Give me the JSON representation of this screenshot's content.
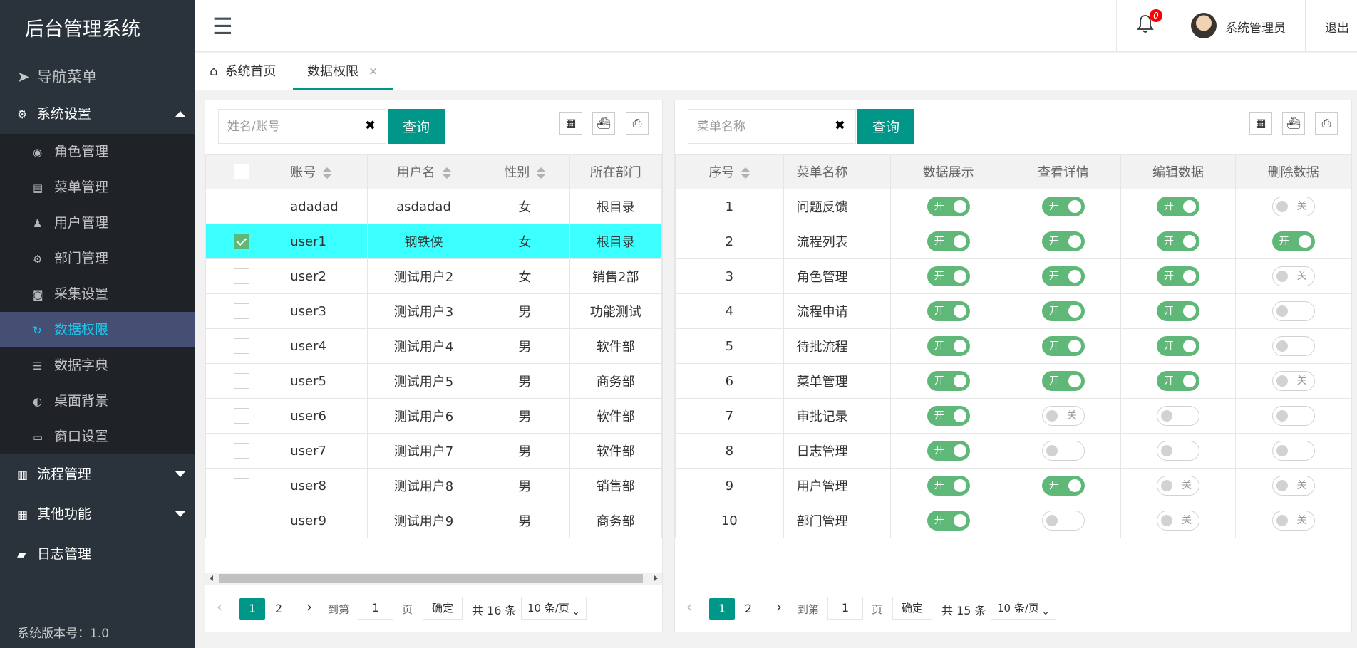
{
  "app": {
    "title": "后台管理系统",
    "version": "系统版本号：1.0"
  },
  "nav": {
    "header": "导航菜单",
    "groups": [
      {
        "label": "系统设置",
        "expanded": true,
        "icon": "gear-icon"
      },
      {
        "label": "流程管理",
        "expanded": false,
        "icon": "workflow-icon"
      },
      {
        "label": "其他功能",
        "expanded": false,
        "icon": "briefcase-icon"
      },
      {
        "label": "日志管理",
        "icon": "book-icon"
      }
    ],
    "sub_items": [
      {
        "label": "角色管理",
        "icon": "radio-icon"
      },
      {
        "label": "菜单管理",
        "icon": "server-icon"
      },
      {
        "label": "用户管理",
        "icon": "user-icon"
      },
      {
        "label": "部门管理",
        "icon": "cogs-icon"
      },
      {
        "label": "采集设置",
        "icon": "camera-icon"
      },
      {
        "label": "数据权限",
        "icon": "refresh-icon",
        "active": true
      },
      {
        "label": "数据字典",
        "icon": "list-icon"
      },
      {
        "label": "桌面背景",
        "icon": "theme-icon"
      },
      {
        "label": "窗口设置",
        "icon": "window-icon"
      }
    ]
  },
  "header": {
    "badge": "0",
    "user_name": "系统管理员",
    "logout": "退出"
  },
  "tabs": {
    "home": "系统首页",
    "active": "数据权限"
  },
  "left": {
    "search_placeholder": "姓名/账号",
    "query_label": "查询",
    "columns": [
      "账号",
      "用户名",
      "性别",
      "所在部门"
    ],
    "rows": [
      {
        "account": "adadad",
        "name": "asdadad",
        "gender": "女",
        "dept": "根目录",
        "checked": false
      },
      {
        "account": "user1",
        "name": "钢铁侠",
        "gender": "女",
        "dept": "根目录",
        "checked": true
      },
      {
        "account": "user2",
        "name": "测试用户2",
        "gender": "女",
        "dept": "销售2部",
        "checked": false
      },
      {
        "account": "user3",
        "name": "测试用户3",
        "gender": "男",
        "dept": "功能测试",
        "checked": false
      },
      {
        "account": "user4",
        "name": "测试用户4",
        "gender": "男",
        "dept": "软件部",
        "checked": false
      },
      {
        "account": "user5",
        "name": "测试用户5",
        "gender": "男",
        "dept": "商务部",
        "checked": false
      },
      {
        "account": "user6",
        "name": "测试用户6",
        "gender": "男",
        "dept": "软件部",
        "checked": false
      },
      {
        "account": "user7",
        "name": "测试用户7",
        "gender": "男",
        "dept": "软件部",
        "checked": false
      },
      {
        "account": "user8",
        "name": "测试用户8",
        "gender": "男",
        "dept": "销售部",
        "checked": false
      },
      {
        "account": "user9",
        "name": "测试用户9",
        "gender": "男",
        "dept": "商务部",
        "checked": false
      }
    ],
    "pager": {
      "pages": [
        "1",
        "2"
      ],
      "goto": "到第",
      "page_value": "1",
      "page_unit": "页",
      "ok": "确定",
      "total": "共 16 条",
      "size": "10 条/页"
    }
  },
  "right": {
    "search_placeholder": "菜单名称",
    "query_label": "查询",
    "columns": [
      "序号",
      "菜单名称",
      "数据展示",
      "查看详情",
      "编辑数据",
      "删除数据"
    ],
    "switch_on": "开",
    "switch_off": "关",
    "rows": [
      {
        "no": "1",
        "menu": "问题反馈",
        "s": [
          true,
          true,
          true,
          false
        ],
        "offText": [
          false,
          false,
          false,
          true
        ]
      },
      {
        "no": "2",
        "menu": "流程列表",
        "s": [
          true,
          true,
          true,
          true
        ],
        "offText": [
          false,
          false,
          false,
          false
        ]
      },
      {
        "no": "3",
        "menu": "角色管理",
        "s": [
          true,
          true,
          true,
          false
        ],
        "offText": [
          false,
          false,
          false,
          true
        ]
      },
      {
        "no": "4",
        "menu": "流程申请",
        "s": [
          true,
          true,
          true,
          false
        ],
        "offText": [
          false,
          false,
          false,
          false
        ]
      },
      {
        "no": "5",
        "menu": "待批流程",
        "s": [
          true,
          true,
          true,
          false
        ],
        "offText": [
          false,
          false,
          false,
          false
        ]
      },
      {
        "no": "6",
        "menu": "菜单管理",
        "s": [
          true,
          true,
          true,
          false
        ],
        "offText": [
          false,
          false,
          false,
          true
        ]
      },
      {
        "no": "7",
        "menu": "审批记录",
        "s": [
          true,
          false,
          false,
          false
        ],
        "offText": [
          false,
          true,
          false,
          false
        ]
      },
      {
        "no": "8",
        "menu": "日志管理",
        "s": [
          true,
          false,
          false,
          false
        ],
        "offText": [
          false,
          false,
          false,
          false
        ]
      },
      {
        "no": "9",
        "menu": "用户管理",
        "s": [
          true,
          true,
          false,
          false
        ],
        "offText": [
          false,
          false,
          true,
          true
        ]
      },
      {
        "no": "10",
        "menu": "部门管理",
        "s": [
          true,
          false,
          false,
          false
        ],
        "offText": [
          false,
          false,
          true,
          true
        ]
      }
    ],
    "pager": {
      "pages": [
        "1",
        "2"
      ],
      "goto": "到第",
      "page_value": "1",
      "page_unit": "页",
      "ok": "确定",
      "total": "共 15 条",
      "size": "10 条/页"
    }
  },
  "colors": {
    "primary": "#009688",
    "switch_on": "#5fb878",
    "sidebar": "#2a333b",
    "active_menu": "#454f74",
    "selected_row": "#3cffff"
  }
}
